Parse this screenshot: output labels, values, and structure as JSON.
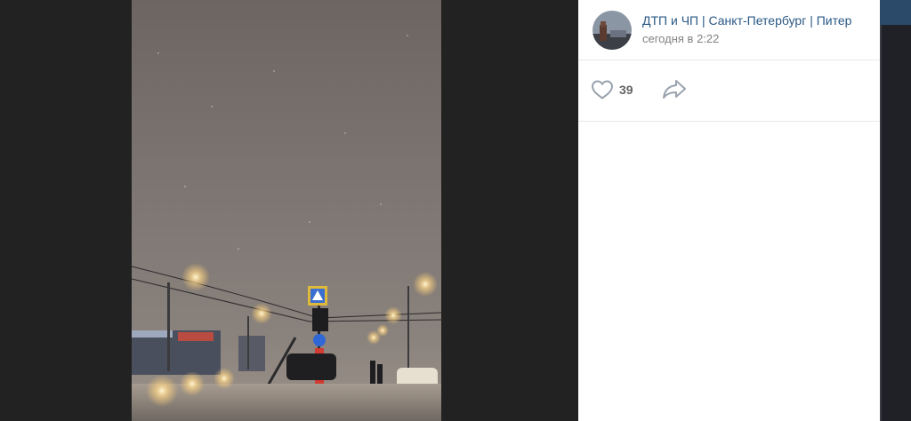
{
  "post": {
    "author": "ДТП и ЧП | Санкт-Петербург | Питер",
    "time": "сегодня в 2:22",
    "likes": "39"
  },
  "photo": {
    "description_icon": "photo"
  },
  "icons": {
    "like": "heart-icon",
    "share": "share-arrow-icon"
  },
  "colors": {
    "link": "#2a5885",
    "muted": "#828282",
    "panel": "#ffffff",
    "backdrop": "#202020"
  }
}
